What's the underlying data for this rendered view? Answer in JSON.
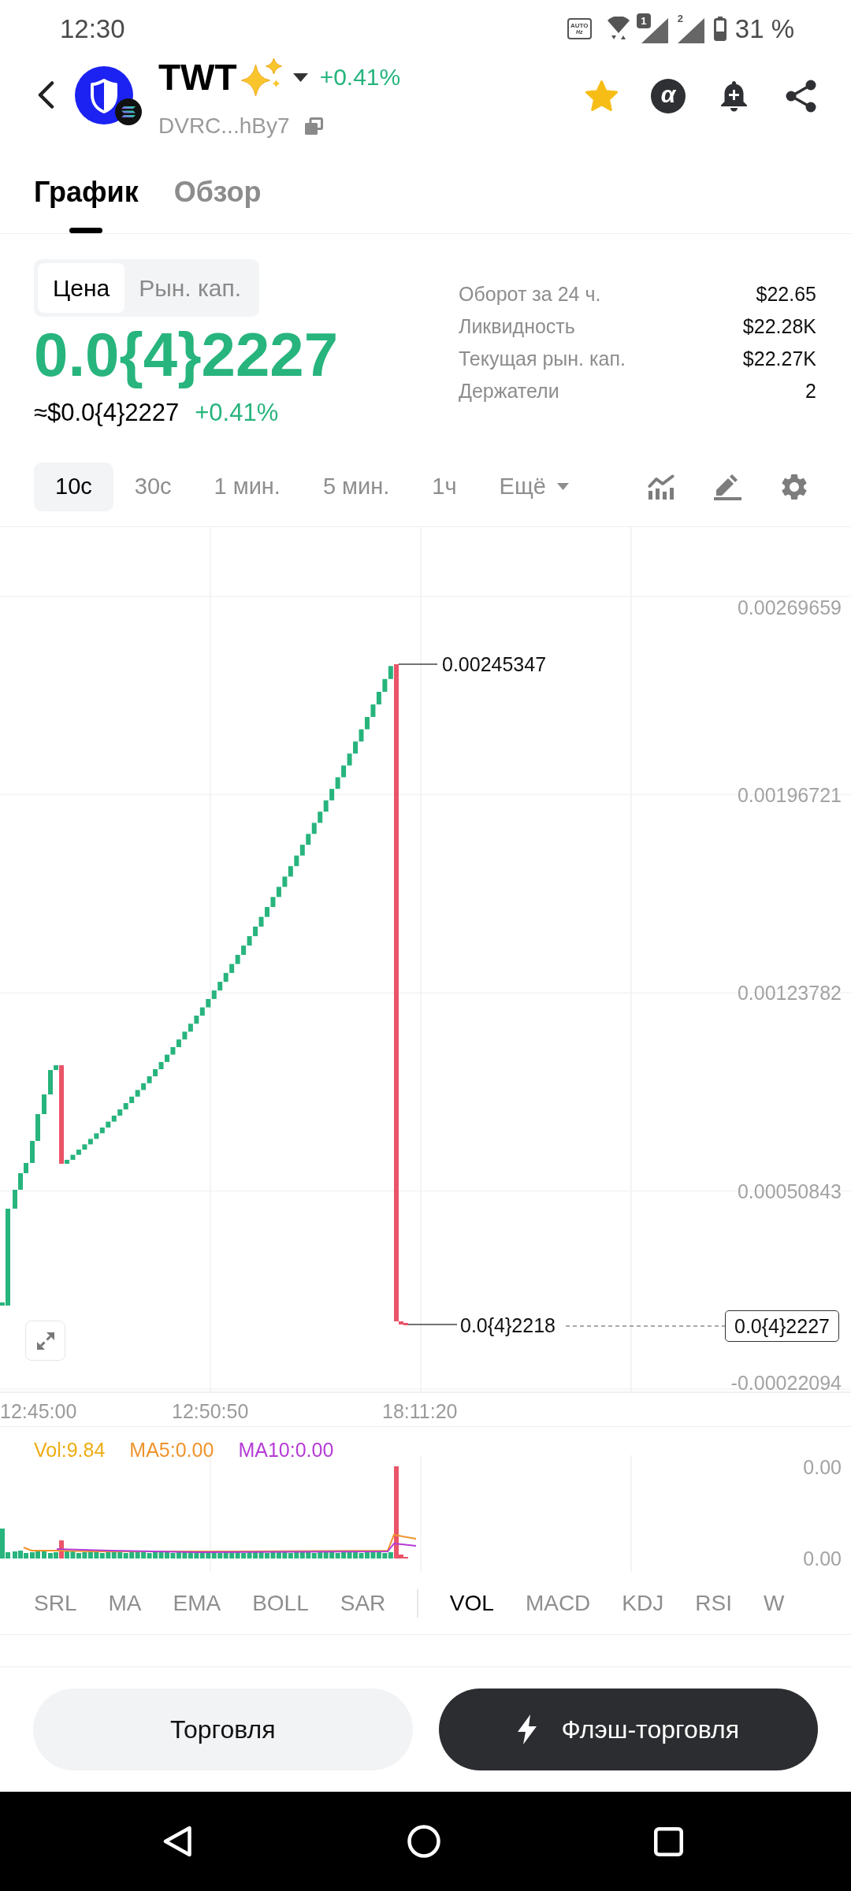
{
  "status_bar": {
    "time": "12:30",
    "refresh_rate": {
      "mode": "AUTO",
      "unit": "Hz"
    },
    "sim_slots": [
      {
        "label": "1",
        "kind": "badge"
      },
      {
        "label": "2",
        "kind": "plain"
      }
    ],
    "battery": "31 %"
  },
  "header": {
    "symbol": "TWT",
    "change": "+0.41%",
    "address": "DVRC...hBy7",
    "favorite": true,
    "alpha_label": "α"
  },
  "tabs": [
    {
      "label": "График",
      "selected": true
    },
    {
      "label": "Обзор",
      "selected": false
    }
  ],
  "price_panel": {
    "modes": [
      {
        "label": "Цена",
        "selected": true
      },
      {
        "label": "Рын. кап.",
        "selected": false
      }
    ],
    "price": "0.0{4}2227",
    "approx_usd": "≈$0.0{4}2227",
    "change": "+0.41%",
    "stats": [
      {
        "label": "Оборот за 24 ч.",
        "value": "$22.65"
      },
      {
        "label": "Ликвидность",
        "value": "$22.28K"
      },
      {
        "label": "Текущая рын. кап.",
        "value": "$22.27K"
      },
      {
        "label": "Держатели",
        "value": "2"
      }
    ]
  },
  "timeframes": {
    "options": [
      {
        "label": "10с",
        "selected": true
      },
      {
        "label": "30с",
        "selected": false
      },
      {
        "label": "1 мин.",
        "selected": false
      },
      {
        "label": "5 мин.",
        "selected": false
      },
      {
        "label": "1ч",
        "selected": false
      }
    ],
    "more_menu": {
      "label": "Ещё"
    }
  },
  "chart": {
    "price_axis": [
      "0.00269659",
      "0.00196721",
      "0.00123782",
      "0.00050843",
      "-0.00022094"
    ],
    "time_axis": [
      "12:45:00",
      "12:50:50",
      "18:11:20"
    ],
    "high_label": "0.00245347",
    "low_label": "0.0{4}2218",
    "last_price_tag": "0.0{4}2227"
  },
  "volume_pane": {
    "legend": [
      {
        "text": "Vol:9.84",
        "color": "#eeac12"
      },
      {
        "text": "MA5:0.00",
        "color": "#f0932b"
      },
      {
        "text": "MA10:0.00",
        "color": "#b53bd6"
      }
    ],
    "axis": [
      "0.00",
      "0.00"
    ]
  },
  "indicators": {
    "overlays": [
      {
        "label": "SRL",
        "selected": false
      },
      {
        "label": "MA",
        "selected": false
      },
      {
        "label": "EMA",
        "selected": false
      },
      {
        "label": "BOLL",
        "selected": false
      },
      {
        "label": "SAR",
        "selected": false
      }
    ],
    "panes": [
      {
        "label": "VOL",
        "selected": true
      },
      {
        "label": "MACD",
        "selected": false
      },
      {
        "label": "KDJ",
        "selected": false
      },
      {
        "label": "RSI",
        "selected": false
      },
      {
        "label": "W",
        "selected": false
      }
    ]
  },
  "buttons": [
    {
      "label": "Торговля",
      "kind": "secondary"
    },
    {
      "label": "Флэш-торговля",
      "kind": "primary"
    }
  ]
}
